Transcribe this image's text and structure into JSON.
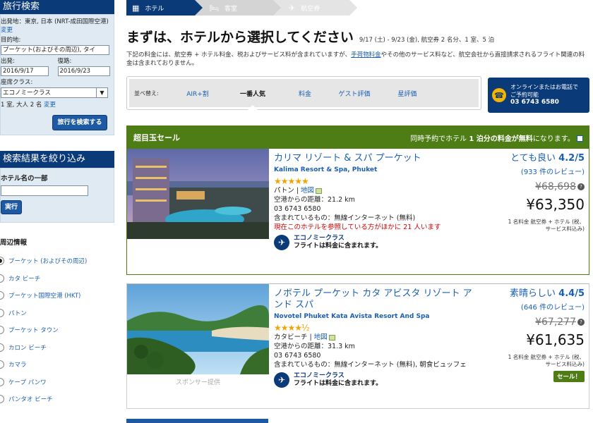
{
  "sidebar": {
    "search_title": "旅行検索",
    "origin_label": "出発地：東京, 日本 (NRT-成田国際空港)",
    "origin_change": "変更",
    "dest_label": "目的地:",
    "dest_value": "プーケット(およびその周辺), タイ",
    "depart_label": "出発:",
    "depart_value": "2016/9/17",
    "return_label": "復路:",
    "return_value": "2016/9/23",
    "cabin_label": "座席クラス:",
    "cabin_value": "エコノミークラス",
    "guests": "1 室, 大人 2 名",
    "guests_change": "変更",
    "search_button": "旅行を検索する",
    "filter_title": "検索結果を絞り込み",
    "hotel_name_label": "ホテル名の一部",
    "run_button": "実行",
    "area_title": "周辺情報",
    "areas": [
      "プーケット (およびその周辺)",
      "カタ ビーチ",
      "プーケット国際空港 (HKT)",
      "パトン",
      "プーケット タウン",
      "カロン ビーチ",
      "カマラ",
      "ケープ パンワ",
      "パンタオ ビーチ"
    ]
  },
  "steps": [
    "ホテル",
    "客室",
    "航空券"
  ],
  "header": {
    "title": "まずは、ホテルから選択してください",
    "subtitle": "9/17 (土) - 9/23 (金), 航空券 2 名分、1 室、5 泊",
    "notice_1": "下記の料金には、航空券 + ホテル料金、税およびサービス料が含まれていますが、",
    "notice_link": "手荷物料金",
    "notice_2": "やその他のサービス料など、航空会社から直接請求されるフライト関連の料金は含まれておりません。"
  },
  "sort": {
    "label": "並べ替え:",
    "items": [
      "AIR+割",
      "一番人気",
      "料金",
      "ゲスト評価",
      "星評価"
    ]
  },
  "contact": {
    "line1": "オンラインまたはお電話で",
    "line2": "ご予約可能",
    "phone": "03 6743 6580"
  },
  "deal": {
    "title": "超目玉セール",
    "right_1": "同時予約でホテル ",
    "right_bold": "1 泊分の料金が無料",
    "right_2": "になります。"
  },
  "hotels": [
    {
      "name_jp": "カリマ リゾート & スパ プーケット",
      "name_en": "Kalima Resort & Spa, Phuket",
      "stars": "★★★★★",
      "star_rating": 5,
      "area": "パトン",
      "map": "地図",
      "airport_distance": "空港からの距離：21.2 km",
      "phone": "03 6743 6580",
      "includes": "含まれているもの：無線インターネット (無料)",
      "alert": "現在このホテルを参照している方がほかに 21 人います",
      "cabin": "エコノミークラス",
      "flight_note": "フライトは料金に含まれます。",
      "rating_word": "とても良い",
      "rating": "4.2/5",
      "reviews": "(933 件のレビュー)",
      "old_price": "¥68,698",
      "price": "¥63,350",
      "price_note_1": "1 名料金 航空券 + ホテル (税、",
      "price_note_2": "サービス料込み)"
    },
    {
      "name_jp": "ノボテル プーケット カタ アビスタ リゾート アンド スパ",
      "name_en": "Novotel Phuket Kata Avista Resort And Spa",
      "stars": "★★★★½",
      "star_rating": 4.5,
      "area": "カタビーチ",
      "map": "地図",
      "airport_distance": "空港からの距離：31.3 km",
      "phone": "03 6743 6580",
      "includes": "含まれているもの：無線インターネット (無料), 朝食ビュッフェ",
      "cabin": "エコノミークラス",
      "flight_note": "フライトは料金に含まれます。",
      "rating_word": "素晴らしい",
      "rating": "4.4/5",
      "reviews": "(646 件のレビュー)",
      "old_price": "¥67,277",
      "price": "¥61,635",
      "price_note_1": "1 名料金 航空券 + ホテル (税、",
      "price_note_2": "サービス料込み)",
      "sale_badge": "セール！",
      "sponsor": "スポンサー提供"
    }
  ]
}
